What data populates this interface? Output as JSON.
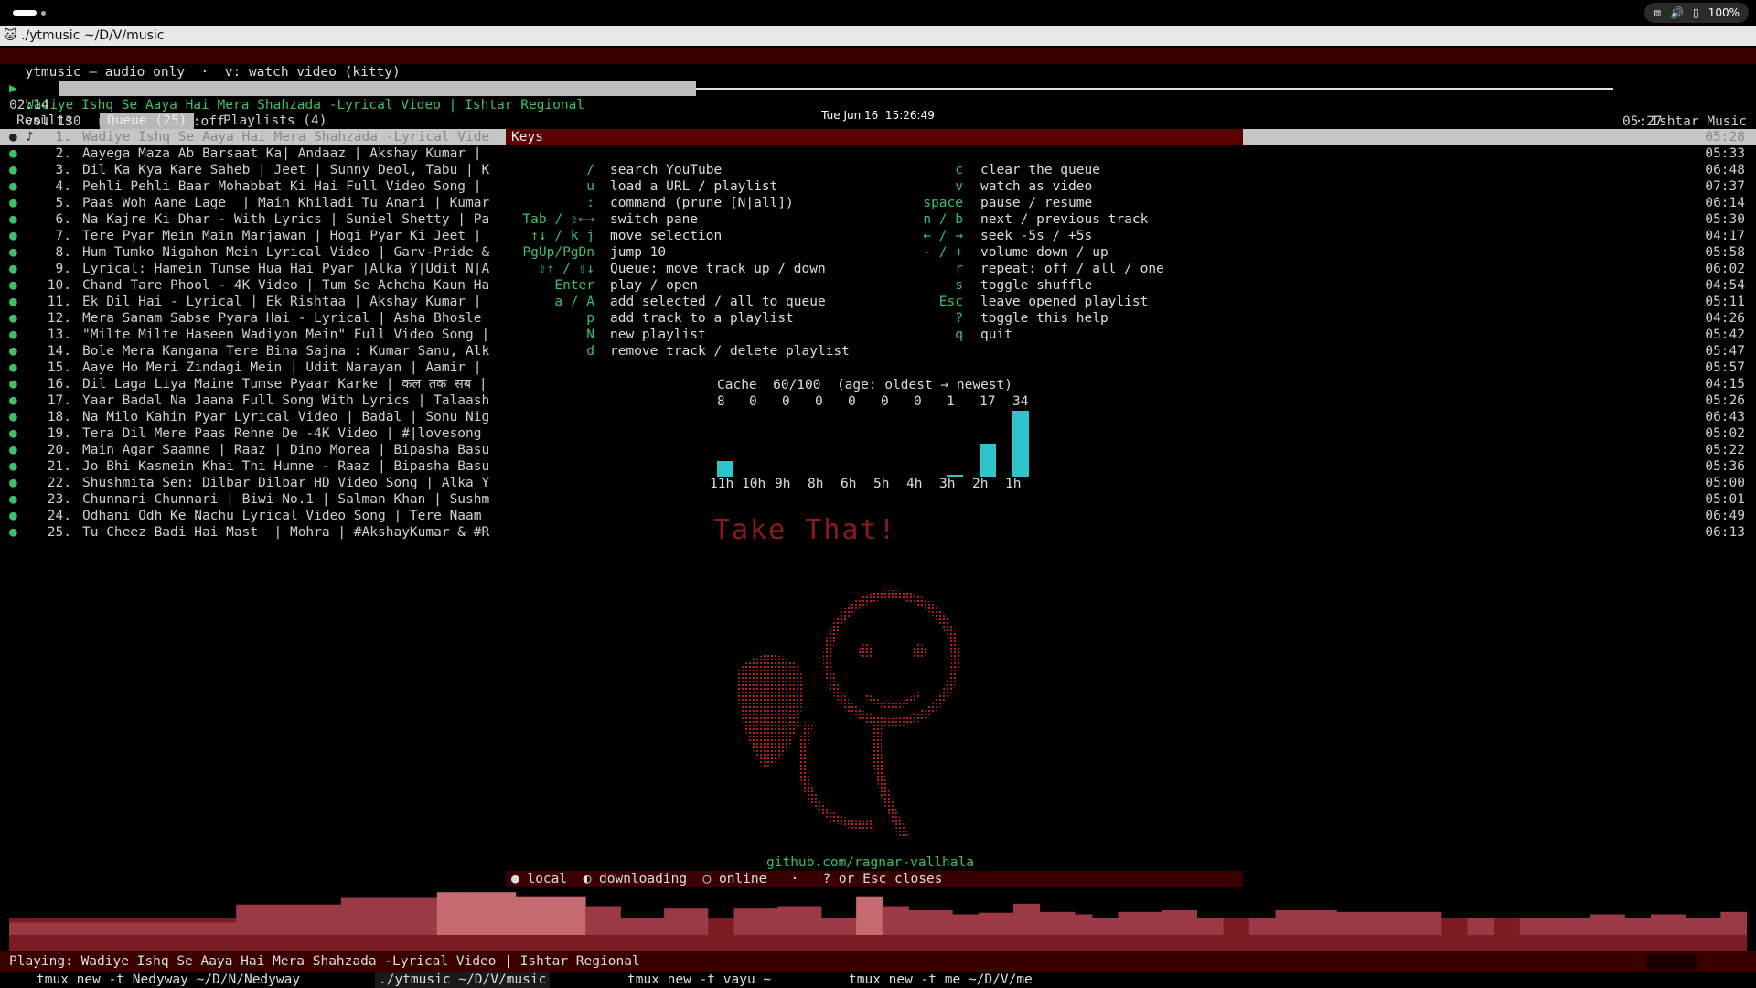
{
  "topbar": {
    "clock": "Tue Jun 16  15:26:49",
    "battery": "100%"
  },
  "window_title": "./ytmusic ~/D/V/music",
  "header": {
    "line1": "ytmusic — audio only  ·  v: watch video (kitty)"
  },
  "now_playing": {
    "marker": "▶",
    "title": "Wadiye Ishq Se Aaya Hai Mera Shahzada -Lyrical Video | Ishtar Regional",
    "channel": "· Ishtar Music"
  },
  "progress": {
    "elapsed": "02:14",
    "total": "05:27",
    "fraction": 0.41
  },
  "status_line": "vol 130  rpt:off  shf:off",
  "tabs": [
    {
      "label": "Results",
      "active": false
    },
    {
      "label": "Queue (25)",
      "active": true
    },
    {
      "label": "Playlists (4)",
      "active": false
    }
  ],
  "queue": [
    {
      "n": "1.",
      "title": "Wadiye Ishq Se Aaya Hai Mera Shahzada -Lyrical Vide",
      "dur": "05:28"
    },
    {
      "n": "2.",
      "title": "Aayega Maza Ab Barsaat Ka| Andaaz | Akshay Kumar |",
      "dur": "05:33"
    },
    {
      "n": "3.",
      "title": "Dil Ka Kya Kare Saheb | Jeet | Sunny Deol, Tabu | K",
      "dur": "06:48"
    },
    {
      "n": "4.",
      "title": "Pehli Pehli Baar Mohabbat Ki Hai Full Video Song |",
      "dur": "07:37"
    },
    {
      "n": "5.",
      "title": "Paas Woh Aane Lage  | Main Khiladi Tu Anari | Kumar",
      "dur": "06:14"
    },
    {
      "n": "6.",
      "title": "Na Kajre Ki Dhar - With Lyrics | Suniel Shetty | Pa",
      "dur": "05:30"
    },
    {
      "n": "7.",
      "title": "Tere Pyar Mein Main Marjawan | Hogi Pyar Ki Jeet |",
      "dur": "04:17"
    },
    {
      "n": "8.",
      "title": "Hum Tumko Nigahon Mein Lyrical Video | Garv-Pride &",
      "dur": "05:58"
    },
    {
      "n": "9.",
      "title": "Lyrical: Hamein Tumse Hua Hai Pyar |Alka Y|Udit N|A",
      "dur": "06:02"
    },
    {
      "n": "10.",
      "title": "Chand Tare Phool - 4K Video | Tum Se Achcha Kaun Ha",
      "dur": "04:54"
    },
    {
      "n": "11.",
      "title": "Ek Dil Hai - Lyrical | Ek Rishtaa | Akshay Kumar |",
      "dur": "05:11"
    },
    {
      "n": "12.",
      "title": "Mera Sanam Sabse Pyara Hai - Lyrical | Asha Bhosle",
      "dur": "04:26"
    },
    {
      "n": "13.",
      "title": "\"Milte Milte Haseen Wadiyon Mein\" Full Video Song |",
      "dur": "05:42"
    },
    {
      "n": "14.",
      "title": "Bole Mera Kangana Tere Bina Sajna : Kumar Sanu, Alk",
      "dur": "05:47"
    },
    {
      "n": "15.",
      "title": "Aaye Ho Meri Zindagi Mein | Udit Narayan | Aamir |",
      "dur": "05:57"
    },
    {
      "n": "16.",
      "title": "Dil Laga Liya Maine Tumse Pyaar Karke | कल तक सब |",
      "dur": "04:15"
    },
    {
      "n": "17.",
      "title": "Yaar Badal Na Jaana Full Song With Lyrics | Talaash",
      "dur": "05:26"
    },
    {
      "n": "18.",
      "title": "Na Milo Kahin Pyar Lyrical Video | Badal | Sonu Nig",
      "dur": "06:43"
    },
    {
      "n": "19.",
      "title": "Tera Dil Mere Paas Rehne De -4K Video | #|lovesong",
      "dur": "05:02"
    },
    {
      "n": "20.",
      "title": "Main Agar Saamne | Raaz | Dino Morea | Bipasha Basu",
      "dur": "05:22"
    },
    {
      "n": "21.",
      "title": "Jo Bhi Kasmein Khai Thi Humne - Raaz | Bipasha Basu",
      "dur": "05:36"
    },
    {
      "n": "22.",
      "title": "Shushmita Sen: Dilbar Dilbar HD Video Song | Alka Y",
      "dur": "05:00"
    },
    {
      "n": "23.",
      "title": "Chunnari Chunnari | Biwi No.1 | Salman Khan | Sushm",
      "dur": "05:01"
    },
    {
      "n": "24.",
      "title": "Odhani Odh Ke Nachu Lyrical Video Song | Tere Naam",
      "dur": "06:49"
    },
    {
      "n": "25.",
      "title": "Tu Cheez Badi Hai Mast  | Mohra | #AkshayKumar & #R",
      "dur": "06:13"
    }
  ],
  "keys": {
    "title": "Keys",
    "left": [
      {
        "key": "/",
        "desc": "search YouTube"
      },
      {
        "key": "u",
        "desc": "load a URL / playlist"
      },
      {
        "key": ":",
        "desc": "command (prune [N|all])"
      },
      {
        "key": "Tab / ⇧←→",
        "desc": "switch pane"
      },
      {
        "key": "↑↓ / k j",
        "desc": "move selection"
      },
      {
        "key": "PgUp/PgDn",
        "desc": "jump 10"
      },
      {
        "key": "⇧↑ / ⇧↓",
        "desc": "Queue: move track up / down"
      },
      {
        "key": "Enter",
        "desc": "play / open"
      },
      {
        "key": "a / A",
        "desc": "add selected / all to queue"
      },
      {
        "key": "p",
        "desc": "add track to a playlist"
      },
      {
        "key": "N",
        "desc": "new playlist"
      },
      {
        "key": "d",
        "desc": "remove track / delete playlist"
      }
    ],
    "right": [
      {
        "key": "c",
        "desc": "clear the queue"
      },
      {
        "key": "v",
        "desc": "watch as video"
      },
      {
        "key": "space",
        "desc": "pause / resume"
      },
      {
        "key": "n / b",
        "desc": "next / previous track"
      },
      {
        "key": "← / →",
        "desc": "seek -5s / +5s"
      },
      {
        "key": "- / +",
        "desc": "volume down / up"
      },
      {
        "key": "r",
        "desc": "repeat: off / all / one"
      },
      {
        "key": "s",
        "desc": "toggle shuffle"
      },
      {
        "key": "Esc",
        "desc": "leave opened playlist"
      },
      {
        "key": "?",
        "desc": "toggle this help"
      },
      {
        "key": "q",
        "desc": "quit"
      }
    ]
  },
  "cache": {
    "label": "Cache  60/100  (age: oldest → newest)",
    "counts": [
      "8",
      "0",
      "0",
      "0",
      "0",
      "0",
      "0",
      "1",
      "17",
      "34"
    ],
    "ages": [
      "11h",
      "10h",
      "9h",
      "8h",
      "6h",
      "5h",
      "4h",
      "3h",
      "2h",
      "1h"
    ],
    "values": [
      8,
      0,
      0,
      0,
      0,
      0,
      0,
      1,
      17,
      34
    ],
    "max": 34
  },
  "art_text": "Take That!",
  "github": "github.com/ragnar-vallhala",
  "legend": "● local  ◐ downloading  ○ online   ·   ? or Esc closes",
  "visualizer": {
    "levels": [
      0.15,
      0.15,
      0.15,
      0.15,
      0.15,
      0.15,
      0.15,
      0.15,
      0.15,
      0.15,
      0.15,
      0.15,
      0.15,
      0.15,
      0.15,
      0.15,
      0.15,
      0.15,
      0.15,
      0.15,
      0.15,
      0.15,
      0.15,
      0.15,
      0.15,
      0.15,
      0.37,
      0.37,
      0.37,
      0.37,
      0.37,
      0.37,
      0.37,
      0.37,
      0.37,
      0.37,
      0.37,
      0.37,
      0.45,
      0.45,
      0.45,
      0.45,
      0.45,
      0.45,
      0.45,
      0.45,
      0.45,
      0.45,
      0.45,
      0.52,
      0.52,
      0.52,
      0.52,
      0.52,
      0.52,
      0.52,
      0.52,
      0.52,
      0.47,
      0.47,
      0.47,
      0.47,
      0.47,
      0.47,
      0.47,
      0.47,
      0.35,
      0.35,
      0.35,
      0.35,
      0.2,
      0.2,
      0.2,
      0.2,
      0.2,
      0.32,
      0.32,
      0.32,
      0.32,
      0.32,
      0.0,
      0.0,
      0.0,
      0.32,
      0.32,
      0.32,
      0.32,
      0.32,
      0.35,
      0.35,
      0.35,
      0.35,
      0.35,
      0.2,
      0.2,
      0.2,
      0.2,
      0.47,
      0.47,
      0.47,
      0.35,
      0.35,
      0.35,
      0.3,
      0.3,
      0.3,
      0.3,
      0.3,
      0.25,
      0.25,
      0.25,
      0.27,
      0.27,
      0.27,
      0.27,
      0.38,
      0.38,
      0.38,
      0.28,
      0.28,
      0.28,
      0.28,
      0.25,
      0.25,
      0.2,
      0.2,
      0.2,
      0.28,
      0.28,
      0.28,
      0.28,
      0.28,
      0.3,
      0.3,
      0.3,
      0.3,
      0.2,
      0.2,
      0.2,
      0.0,
      0.0,
      0.0,
      0.2,
      0.2,
      0.2,
      0.3,
      0.3,
      0.3,
      0.3,
      0.3,
      0.3,
      0.3,
      0.28,
      0.28,
      0.28,
      0.28,
      0.28,
      0.28,
      0.28,
      0.28,
      0.28,
      0.28,
      0.28,
      0.28,
      0.0,
      0.0,
      0.0,
      0.2,
      0.2,
      0.2,
      0.0,
      0.0,
      0.0,
      0.2,
      0.2,
      0.2,
      0.2,
      0.2,
      0.2,
      0.2,
      0.2,
      0.25,
      0.25,
      0.25,
      0.25,
      0.2,
      0.2,
      0.2,
      0.25,
      0.25,
      0.25,
      0.25,
      0.2,
      0.2,
      0.2,
      0.2,
      0.28,
      0.28,
      0.28
    ]
  },
  "status_bar": "Playing: Wadiye Ishq Se Aaya Hai Mera Shahzada -Lyrical Video | Ishtar Regional",
  "tmux_windows": [
    {
      "label": "tmux new -t Nedyway ~/D/N/Nedyway",
      "active": false
    },
    {
      "label": "./ytmusic ~/D/V/music",
      "active": true
    },
    {
      "label": "tmux new -t vayu ~",
      "active": false
    },
    {
      "label": "tmux new -t me ~/D/V/me",
      "active": false
    }
  ]
}
